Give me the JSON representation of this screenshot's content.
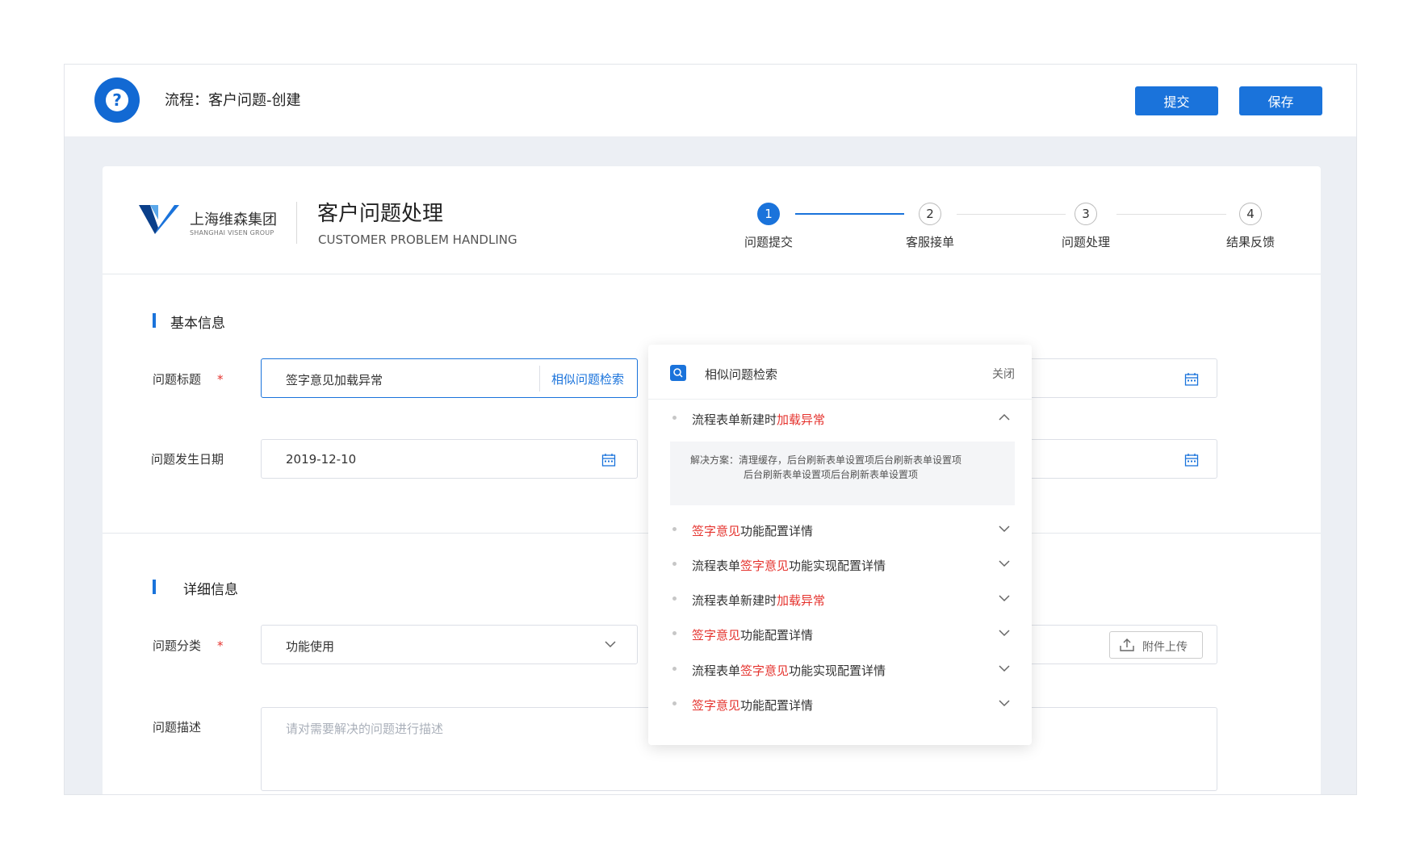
{
  "topbar": {
    "title": "流程：客户问题-创建",
    "submit_label": "提交",
    "save_label": "保存",
    "help_icon": "question-circle-icon"
  },
  "header": {
    "logo_cn": "上海维森集团",
    "logo_en": "SHANGHAI VISEN GROUP",
    "title": "客户问题处理",
    "subtitle": "CUSTOMER PROBLEM HANDLING"
  },
  "steps": [
    {
      "num": "1",
      "label": "问题提交",
      "active": true
    },
    {
      "num": "2",
      "label": "客服接单",
      "active": false
    },
    {
      "num": "3",
      "label": "问题处理",
      "active": false
    },
    {
      "num": "4",
      "label": "结果反馈",
      "active": false
    }
  ],
  "basic": {
    "section_title": "基本信息",
    "title_label": "问题标题",
    "title_value": "签字意见加载异常",
    "search_link": "相似问题检索",
    "date_label": "问题发生日期",
    "date_value": "2019-12-10",
    "required_mark": "*"
  },
  "detail": {
    "section_title": "详细信息",
    "category_label": "问题分类",
    "category_value": "功能使用",
    "desc_label": "问题描述",
    "desc_placeholder": "请对需要解决的问题进行描述",
    "upload_label": "附件上传"
  },
  "popover": {
    "title": "相似问题检索",
    "close": "关闭",
    "solution_line1": "解决方案：清理缓存，后台刷新表单设置项后台刷新表单设置项",
    "solution_line2": "后台刷新表单设置项后台刷新表单设置项",
    "items": [
      {
        "pre": "流程表单新建时",
        "hl": "加载异常",
        "post": ""
      },
      {
        "pre": "",
        "hl": "签字意见",
        "post": "功能配置详情"
      },
      {
        "pre": "流程表单",
        "hl": "签字意见",
        "post": "功能实现配置详情"
      },
      {
        "pre": "流程表单新建时",
        "hl": "加载异常",
        "post": ""
      },
      {
        "pre": "",
        "hl": "签字意见",
        "post": "功能配置详情"
      },
      {
        "pre": "流程表单",
        "hl": "签字意见",
        "post": "功能实现配置详情"
      },
      {
        "pre": "",
        "hl": "签字意见",
        "post": "功能配置详情"
      }
    ]
  },
  "colors": {
    "accent": "#1a73db",
    "highlight": "#e5332e"
  }
}
